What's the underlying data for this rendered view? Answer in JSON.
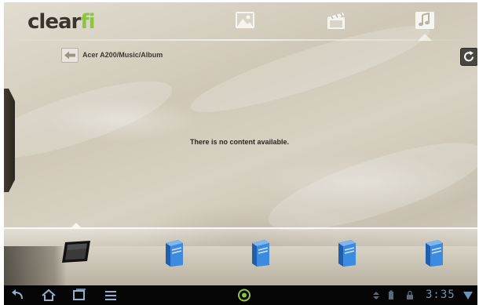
{
  "app": {
    "logo_main": "clear",
    "logo_accent": "fi",
    "tabs": [
      {
        "icon": "photo-icon"
      },
      {
        "icon": "video-icon"
      },
      {
        "icon": "music-icon",
        "selected": true
      }
    ]
  },
  "breadcrumb": "Acer A200/Music/Album",
  "empty_message": "There is no content available.",
  "devices": [
    {
      "icon": "tablet-icon",
      "selected": true
    },
    {
      "icon": "server-icon"
    },
    {
      "icon": "server-icon"
    },
    {
      "icon": "server-icon"
    },
    {
      "icon": "server-icon"
    }
  ],
  "navbar": {
    "buttons": [
      "back-icon",
      "home-icon",
      "recent-apps-icon",
      "menu-icon"
    ],
    "center_icon": "app-indicator-icon",
    "clock": "3:35"
  },
  "colors": {
    "logo_accent": "#8cc63f",
    "clock": "#6f93b5",
    "server_blue": "#2f7bd6"
  }
}
